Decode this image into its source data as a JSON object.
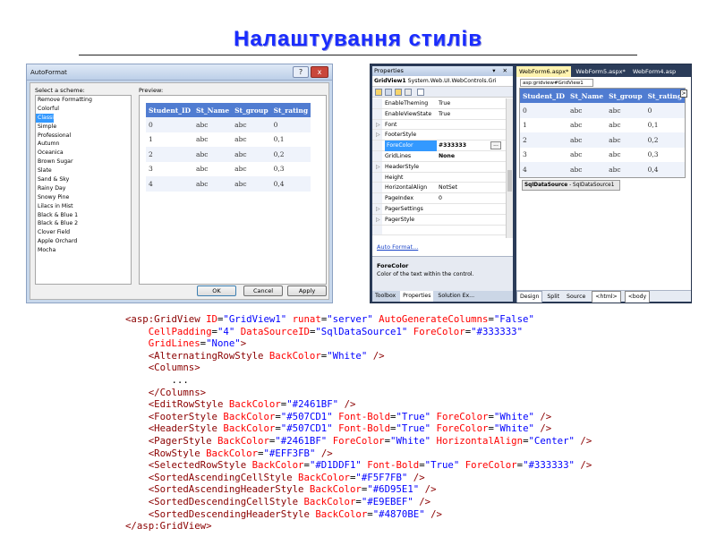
{
  "title": "Налаштування стилів",
  "autoformat": {
    "window_title": "AutoFormat",
    "help_label": "?",
    "close_label": "x",
    "scheme_label": "Select a scheme:",
    "preview_label": "Preview:",
    "schemes": [
      "Remove Formatting",
      "Colorful",
      "Classic",
      "Simple",
      "Professional",
      "Autumn",
      "Oceanica",
      "Brown Sugar",
      "Slate",
      "Sand & Sky",
      "Rainy Day",
      "Snowy Pine",
      "Lilacs in Mist",
      "Black & Blue 1",
      "Black & Blue 2",
      "Clover Field",
      "Apple Orchard",
      "Mocha"
    ],
    "selected_scheme": "Classic",
    "ok_label": "OK",
    "cancel_label": "Cancel",
    "apply_label": "Apply"
  },
  "grid": {
    "columns": [
      "Student_ID",
      "St_Name",
      "St_group",
      "St_rating"
    ],
    "rows": [
      [
        "0",
        "abc",
        "abc",
        "0"
      ],
      [
        "1",
        "abc",
        "abc",
        "0,1"
      ],
      [
        "2",
        "abc",
        "abc",
        "0,2"
      ],
      [
        "3",
        "abc",
        "abc",
        "0,3"
      ],
      [
        "4",
        "abc",
        "abc",
        "0,4"
      ]
    ],
    "header_color": "#507CD1",
    "alt_row_color": "#EFF3FB"
  },
  "properties": {
    "title": "Properties",
    "title_controls": "▾ ✕",
    "object_name": "GridView1",
    "object_type": "System.Web.UI.WebControls.Gri",
    "rows": [
      {
        "expand": "",
        "name": "EnableTheming",
        "value": "True"
      },
      {
        "expand": "",
        "name": "EnableViewState",
        "value": "True"
      },
      {
        "expand": "▷",
        "name": "Font",
        "value": ""
      },
      {
        "expand": "▷",
        "name": "FooterStyle",
        "value": ""
      },
      {
        "expand": "",
        "name": "ForeColor",
        "value": "#333333"
      },
      {
        "expand": "",
        "name": "GridLines",
        "value": "None"
      },
      {
        "expand": "▷",
        "name": "HeaderStyle",
        "value": ""
      },
      {
        "expand": "",
        "name": "Height",
        "value": ""
      },
      {
        "expand": "",
        "name": "HorizontalAlign",
        "value": "NotSet"
      },
      {
        "expand": "",
        "name": "PageIndex",
        "value": "0"
      },
      {
        "expand": "▷",
        "name": "PagerSettings",
        "value": ""
      },
      {
        "expand": "▷",
        "name": "PagerStyle",
        "value": ""
      },
      {
        "expand": "",
        "name": "",
        "value": ""
      }
    ],
    "selected_row": "ForeColor",
    "ellipsis": "...",
    "link": "Auto Format...",
    "desc_name": "ForeColor",
    "desc_text": "Color of the text within the control.",
    "tabs": [
      "Toolbox",
      "Properties",
      "Solution Ex..."
    ]
  },
  "docs": {
    "tabs": [
      "WebForm6.aspx*",
      "WebForm5.aspx*",
      "WebForm4.asp"
    ],
    "tag_path": "asp:gridview#GridView1",
    "chevron": ">",
    "datasource_name": "SqlDataSource",
    "datasource_id": " - SqlDataSource1",
    "bottom_tabs": [
      "Design",
      "Split",
      "Source"
    ],
    "tag_buttons": [
      "<html>",
      "<body"
    ]
  },
  "code_lines": [
    [
      [
        "t",
        "<asp:GridView "
      ],
      [
        "a",
        "ID"
      ],
      [
        "x",
        "="
      ],
      [
        "v",
        "\"GridView1\""
      ],
      [
        "x",
        " "
      ],
      [
        "a",
        "runat"
      ],
      [
        "x",
        "="
      ],
      [
        "v",
        "\"server\""
      ],
      [
        "x",
        " "
      ],
      [
        "a",
        "AutoGenerateColumns"
      ],
      [
        "x",
        "="
      ],
      [
        "v",
        "\"False\""
      ]
    ],
    [
      [
        "x",
        "    "
      ],
      [
        "a",
        "CellPadding"
      ],
      [
        "x",
        "="
      ],
      [
        "v",
        "\"4\""
      ],
      [
        "x",
        " "
      ],
      [
        "a",
        "DataSourceID"
      ],
      [
        "x",
        "="
      ],
      [
        "v",
        "\"SqlDataSource1\""
      ],
      [
        "x",
        " "
      ],
      [
        "a",
        "ForeColor"
      ],
      [
        "x",
        "="
      ],
      [
        "v",
        "\"#333333\""
      ]
    ],
    [
      [
        "x",
        "    "
      ],
      [
        "a",
        "GridLines"
      ],
      [
        "x",
        "="
      ],
      [
        "v",
        "\"None\""
      ],
      [
        "t",
        ">"
      ]
    ],
    [
      [
        "x",
        "    "
      ],
      [
        "t",
        "<AlternatingRowStyle "
      ],
      [
        "a",
        "BackColor"
      ],
      [
        "x",
        "="
      ],
      [
        "v",
        "\"White\""
      ],
      [
        "x",
        " "
      ],
      [
        "t",
        "/>"
      ]
    ],
    [
      [
        "x",
        "    "
      ],
      [
        "t",
        "<Columns>"
      ]
    ],
    [
      [
        "x",
        "        ..."
      ]
    ],
    [
      [
        "x",
        "    "
      ],
      [
        "t",
        "</Columns>"
      ]
    ],
    [
      [
        "x",
        "    "
      ],
      [
        "t",
        "<EditRowStyle "
      ],
      [
        "a",
        "BackColor"
      ],
      [
        "x",
        "="
      ],
      [
        "v",
        "\"#2461BF\""
      ],
      [
        "x",
        " "
      ],
      [
        "t",
        "/>"
      ]
    ],
    [
      [
        "x",
        "    "
      ],
      [
        "t",
        "<FooterStyle "
      ],
      [
        "a",
        "BackColor"
      ],
      [
        "x",
        "="
      ],
      [
        "v",
        "\"#507CD1\""
      ],
      [
        "x",
        " "
      ],
      [
        "a",
        "Font-Bold"
      ],
      [
        "x",
        "="
      ],
      [
        "v",
        "\"True\""
      ],
      [
        "x",
        " "
      ],
      [
        "a",
        "ForeColor"
      ],
      [
        "x",
        "="
      ],
      [
        "v",
        "\"White\""
      ],
      [
        "x",
        " "
      ],
      [
        "t",
        "/>"
      ]
    ],
    [
      [
        "x",
        "    "
      ],
      [
        "t",
        "<HeaderStyle "
      ],
      [
        "a",
        "BackColor"
      ],
      [
        "x",
        "="
      ],
      [
        "v",
        "\"#507CD1\""
      ],
      [
        "x",
        " "
      ],
      [
        "a",
        "Font-Bold"
      ],
      [
        "x",
        "="
      ],
      [
        "v",
        "\"True\""
      ],
      [
        "x",
        " "
      ],
      [
        "a",
        "ForeColor"
      ],
      [
        "x",
        "="
      ],
      [
        "v",
        "\"White\""
      ],
      [
        "x",
        " "
      ],
      [
        "t",
        "/>"
      ]
    ],
    [
      [
        "x",
        "    "
      ],
      [
        "t",
        "<PagerStyle "
      ],
      [
        "a",
        "BackColor"
      ],
      [
        "x",
        "="
      ],
      [
        "v",
        "\"#2461BF\""
      ],
      [
        "x",
        " "
      ],
      [
        "a",
        "ForeColor"
      ],
      [
        "x",
        "="
      ],
      [
        "v",
        "\"White\""
      ],
      [
        "x",
        " "
      ],
      [
        "a",
        "HorizontalAlign"
      ],
      [
        "x",
        "="
      ],
      [
        "v",
        "\"Center\""
      ],
      [
        "x",
        " "
      ],
      [
        "t",
        "/>"
      ]
    ],
    [
      [
        "x",
        "    "
      ],
      [
        "t",
        "<RowStyle "
      ],
      [
        "a",
        "BackColor"
      ],
      [
        "x",
        "="
      ],
      [
        "v",
        "\"#EFF3FB\""
      ],
      [
        "x",
        " "
      ],
      [
        "t",
        "/>"
      ]
    ],
    [
      [
        "x",
        "    "
      ],
      [
        "t",
        "<SelectedRowStyle "
      ],
      [
        "a",
        "BackColor"
      ],
      [
        "x",
        "="
      ],
      [
        "v",
        "\"#D1DDF1\""
      ],
      [
        "x",
        " "
      ],
      [
        "a",
        "Font-Bold"
      ],
      [
        "x",
        "="
      ],
      [
        "v",
        "\"True\""
      ],
      [
        "x",
        " "
      ],
      [
        "a",
        "ForeColor"
      ],
      [
        "x",
        "="
      ],
      [
        "v",
        "\"#333333\""
      ],
      [
        "x",
        " "
      ],
      [
        "t",
        "/>"
      ]
    ],
    [
      [
        "x",
        "    "
      ],
      [
        "t",
        "<SortedAscendingCellStyle "
      ],
      [
        "a",
        "BackColor"
      ],
      [
        "x",
        "="
      ],
      [
        "v",
        "\"#F5F7FB\""
      ],
      [
        "x",
        " "
      ],
      [
        "t",
        "/>"
      ]
    ],
    [
      [
        "x",
        "    "
      ],
      [
        "t",
        "<SortedAscendingHeaderStyle "
      ],
      [
        "a",
        "BackColor"
      ],
      [
        "x",
        "="
      ],
      [
        "v",
        "\"#6D95E1\""
      ],
      [
        "x",
        " "
      ],
      [
        "t",
        "/>"
      ]
    ],
    [
      [
        "x",
        "    "
      ],
      [
        "t",
        "<SortedDescendingCellStyle "
      ],
      [
        "a",
        "BackColor"
      ],
      [
        "x",
        "="
      ],
      [
        "v",
        "\"#E9EBEF\""
      ],
      [
        "x",
        " "
      ],
      [
        "t",
        "/>"
      ]
    ],
    [
      [
        "x",
        "    "
      ],
      [
        "t",
        "<SortedDescendingHeaderStyle "
      ],
      [
        "a",
        "BackColor"
      ],
      [
        "x",
        "="
      ],
      [
        "v",
        "\"#4870BE\""
      ],
      [
        "x",
        " "
      ],
      [
        "t",
        "/>"
      ]
    ],
    [
      [
        "t",
        "</asp:GridView>"
      ]
    ]
  ]
}
